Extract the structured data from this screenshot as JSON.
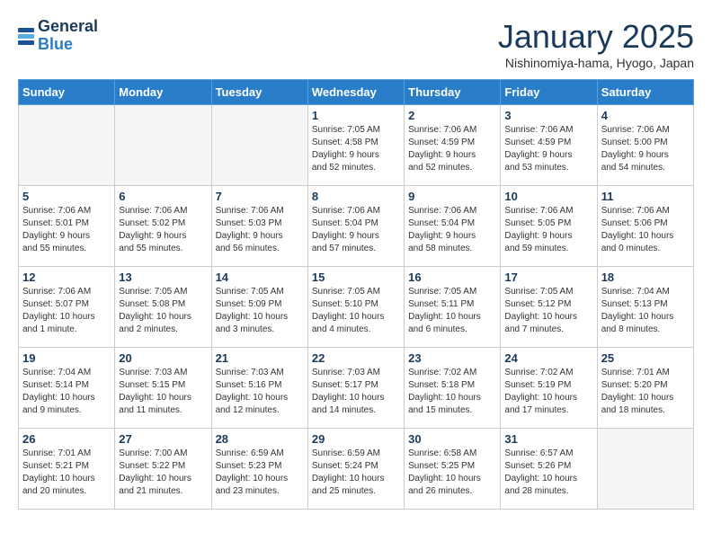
{
  "header": {
    "logo_general": "General",
    "logo_blue": "Blue",
    "title": "January 2025",
    "subtitle": "Nishinomiya-hama, Hyogo, Japan"
  },
  "days_of_week": [
    "Sunday",
    "Monday",
    "Tuesday",
    "Wednesday",
    "Thursday",
    "Friday",
    "Saturday"
  ],
  "weeks": [
    {
      "cells": [
        {
          "empty": true
        },
        {
          "empty": true
        },
        {
          "empty": true
        },
        {
          "day": "1",
          "text": "Sunrise: 7:05 AM\nSunset: 4:58 PM\nDaylight: 9 hours\nand 52 minutes."
        },
        {
          "day": "2",
          "text": "Sunrise: 7:06 AM\nSunset: 4:59 PM\nDaylight: 9 hours\nand 52 minutes."
        },
        {
          "day": "3",
          "text": "Sunrise: 7:06 AM\nSunset: 4:59 PM\nDaylight: 9 hours\nand 53 minutes."
        },
        {
          "day": "4",
          "text": "Sunrise: 7:06 AM\nSunset: 5:00 PM\nDaylight: 9 hours\nand 54 minutes."
        }
      ]
    },
    {
      "cells": [
        {
          "day": "5",
          "text": "Sunrise: 7:06 AM\nSunset: 5:01 PM\nDaylight: 9 hours\nand 55 minutes."
        },
        {
          "day": "6",
          "text": "Sunrise: 7:06 AM\nSunset: 5:02 PM\nDaylight: 9 hours\nand 55 minutes."
        },
        {
          "day": "7",
          "text": "Sunrise: 7:06 AM\nSunset: 5:03 PM\nDaylight: 9 hours\nand 56 minutes."
        },
        {
          "day": "8",
          "text": "Sunrise: 7:06 AM\nSunset: 5:04 PM\nDaylight: 9 hours\nand 57 minutes."
        },
        {
          "day": "9",
          "text": "Sunrise: 7:06 AM\nSunset: 5:04 PM\nDaylight: 9 hours\nand 58 minutes."
        },
        {
          "day": "10",
          "text": "Sunrise: 7:06 AM\nSunset: 5:05 PM\nDaylight: 9 hours\nand 59 minutes."
        },
        {
          "day": "11",
          "text": "Sunrise: 7:06 AM\nSunset: 5:06 PM\nDaylight: 10 hours\nand 0 minutes."
        }
      ]
    },
    {
      "cells": [
        {
          "day": "12",
          "text": "Sunrise: 7:06 AM\nSunset: 5:07 PM\nDaylight: 10 hours\nand 1 minute."
        },
        {
          "day": "13",
          "text": "Sunrise: 7:05 AM\nSunset: 5:08 PM\nDaylight: 10 hours\nand 2 minutes."
        },
        {
          "day": "14",
          "text": "Sunrise: 7:05 AM\nSunset: 5:09 PM\nDaylight: 10 hours\nand 3 minutes."
        },
        {
          "day": "15",
          "text": "Sunrise: 7:05 AM\nSunset: 5:10 PM\nDaylight: 10 hours\nand 4 minutes."
        },
        {
          "day": "16",
          "text": "Sunrise: 7:05 AM\nSunset: 5:11 PM\nDaylight: 10 hours\nand 6 minutes."
        },
        {
          "day": "17",
          "text": "Sunrise: 7:05 AM\nSunset: 5:12 PM\nDaylight: 10 hours\nand 7 minutes."
        },
        {
          "day": "18",
          "text": "Sunrise: 7:04 AM\nSunset: 5:13 PM\nDaylight: 10 hours\nand 8 minutes."
        }
      ]
    },
    {
      "cells": [
        {
          "day": "19",
          "text": "Sunrise: 7:04 AM\nSunset: 5:14 PM\nDaylight: 10 hours\nand 9 minutes."
        },
        {
          "day": "20",
          "text": "Sunrise: 7:03 AM\nSunset: 5:15 PM\nDaylight: 10 hours\nand 11 minutes."
        },
        {
          "day": "21",
          "text": "Sunrise: 7:03 AM\nSunset: 5:16 PM\nDaylight: 10 hours\nand 12 minutes."
        },
        {
          "day": "22",
          "text": "Sunrise: 7:03 AM\nSunset: 5:17 PM\nDaylight: 10 hours\nand 14 minutes."
        },
        {
          "day": "23",
          "text": "Sunrise: 7:02 AM\nSunset: 5:18 PM\nDaylight: 10 hours\nand 15 minutes."
        },
        {
          "day": "24",
          "text": "Sunrise: 7:02 AM\nSunset: 5:19 PM\nDaylight: 10 hours\nand 17 minutes."
        },
        {
          "day": "25",
          "text": "Sunrise: 7:01 AM\nSunset: 5:20 PM\nDaylight: 10 hours\nand 18 minutes."
        }
      ]
    },
    {
      "cells": [
        {
          "day": "26",
          "text": "Sunrise: 7:01 AM\nSunset: 5:21 PM\nDaylight: 10 hours\nand 20 minutes."
        },
        {
          "day": "27",
          "text": "Sunrise: 7:00 AM\nSunset: 5:22 PM\nDaylight: 10 hours\nand 21 minutes."
        },
        {
          "day": "28",
          "text": "Sunrise: 6:59 AM\nSunset: 5:23 PM\nDaylight: 10 hours\nand 23 minutes."
        },
        {
          "day": "29",
          "text": "Sunrise: 6:59 AM\nSunset: 5:24 PM\nDaylight: 10 hours\nand 25 minutes."
        },
        {
          "day": "30",
          "text": "Sunrise: 6:58 AM\nSunset: 5:25 PM\nDaylight: 10 hours\nand 26 minutes."
        },
        {
          "day": "31",
          "text": "Sunrise: 6:57 AM\nSunset: 5:26 PM\nDaylight: 10 hours\nand 28 minutes."
        },
        {
          "empty": true
        }
      ]
    }
  ]
}
